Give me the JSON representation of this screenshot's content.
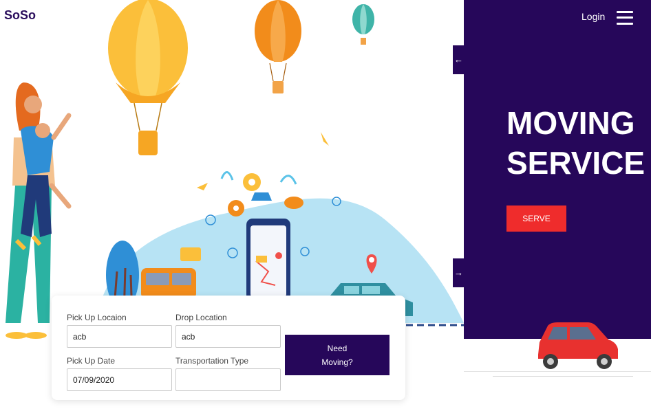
{
  "brand": {
    "logo_text": "SoSo"
  },
  "header": {
    "login_label": "Login"
  },
  "hero": {
    "title_line1": "MOVING",
    "title_line2": "SERVICE",
    "cta_label": "SERVE"
  },
  "slider": {
    "prev_icon": "←",
    "next_icon": "→"
  },
  "booking": {
    "pickup_label": "Pick Up Locaion",
    "pickup_value": "acb",
    "drop_label": "Drop Location",
    "drop_value": "acb",
    "date_label": "Pick Up Date",
    "date_value": "07/09/2020",
    "transport_label": "Transportation Type",
    "transport_value": "",
    "submit_line1": "Need",
    "submit_line2": "Moving?"
  },
  "colors": {
    "primary": "#26075a",
    "accent": "#ef2c2c",
    "balloon_yellow": "#fbbf3a",
    "balloon_orange": "#f28c1b",
    "balloon_teal": "#3fb4a8",
    "hill": "#b7e3f4",
    "car_red": "#e8312f"
  },
  "icons": [
    "menu-icon",
    "arrow-left-icon",
    "arrow-right-icon",
    "map-pin-icon",
    "gear-icon",
    "paper-plane-icon",
    "smartphone-icon"
  ]
}
